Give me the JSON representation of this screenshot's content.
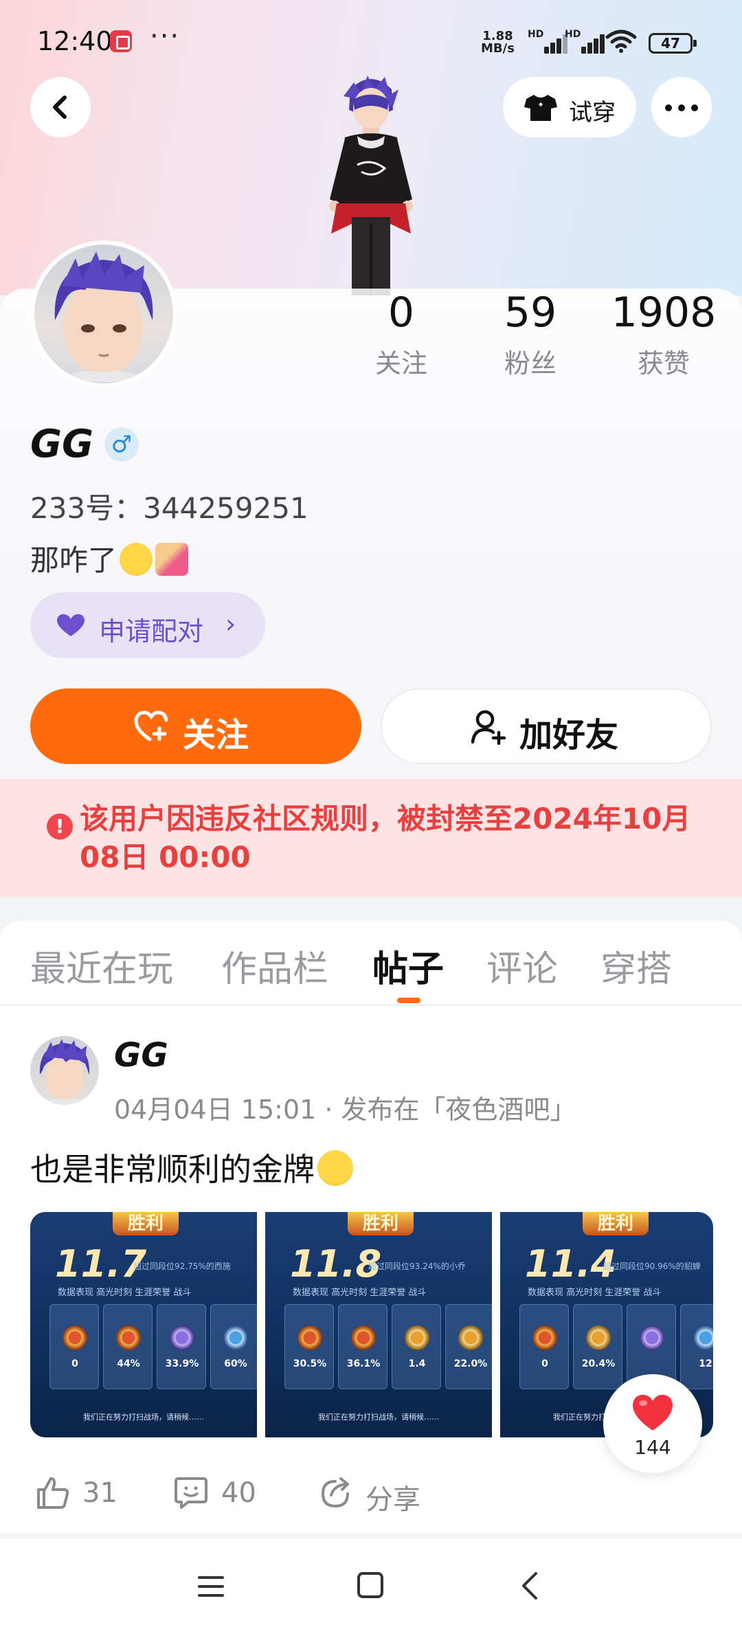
{
  "status_bar": {
    "time": "12:40",
    "more": "···",
    "net_speed_top": "1.88",
    "net_speed_bottom": "MB/s",
    "hd_label_1": "HD",
    "hd_label_2": "HD",
    "battery": "47"
  },
  "header": {
    "tryon_label": "试穿"
  },
  "stats": [
    {
      "value": "0",
      "label": "关注"
    },
    {
      "value": "59",
      "label": "粉丝"
    },
    {
      "value": "1908",
      "label": "获赞"
    }
  ],
  "profile": {
    "username": "GG",
    "gender_symbol": "♂",
    "uid": "233号：344259251",
    "bio": "那咋了",
    "pair_label": "申请配对",
    "pair_chevron": "›"
  },
  "buttons": {
    "follow_label": "关注",
    "add_friend_label": "加好友"
  },
  "ban_notice": {
    "icon": "!",
    "text": "该用户因违反社区规则，被封禁至2024年10月08日 00:00"
  },
  "tabs": [
    {
      "label": "最近在玩"
    },
    {
      "label": "作品栏"
    },
    {
      "label": "帖子"
    },
    {
      "label": "评论"
    },
    {
      "label": "穿搭"
    }
  ],
  "active_tab": "帖子",
  "post": {
    "username": "GG",
    "meta": "04月04日 15:01 · 发布在「夜色酒吧」",
    "text": "也是非常顺利的金牌",
    "screenshots": [
      {
        "banner": "胜利",
        "score": "11.7",
        "sub": "超过同段位92.75%的西施",
        "tabs": "数据表现   高光时刻   生涯荣誉   战斗",
        "stats": [
          "0",
          "44%",
          "33.9%",
          "60%"
        ],
        "footer": "我们正在努力打扫战场，请稍候……"
      },
      {
        "banner": "胜利",
        "score": "11.8",
        "sub": "超过同段位93.24%的小乔",
        "tabs": "数据表现   高光时刻   生涯荣誉   战斗",
        "stats": [
          "30.5%",
          "36.1%",
          "1.4",
          "22.0%"
        ],
        "footer": "我们正在努力打扫战场，请稍候……"
      },
      {
        "banner": "胜利",
        "score": "11.4",
        "sub": "超过同段位90.96%的貂蝉",
        "tabs": "数据表现   高光时刻   生涯荣誉   战斗",
        "stats": [
          "0",
          "20.4%",
          "",
          "12"
        ],
        "footer": "我们正在努力打扫战场，请稍候……"
      }
    ],
    "likes": "31",
    "comments": "40",
    "share_label": "分享",
    "fab_likes": "144"
  },
  "colors": {
    "accent_orange": "#ff6b0d",
    "ban_red": "#e8403e",
    "pair_purple": "#6d4fd0"
  },
  "icons": [
    "back-arrow-icon",
    "tshirt-icon",
    "more-dots-icon",
    "heart-icon",
    "heart-plus-icon",
    "add-user-icon",
    "warning-icon",
    "thumbs-up-icon",
    "comment-icon",
    "share-icon"
  ]
}
